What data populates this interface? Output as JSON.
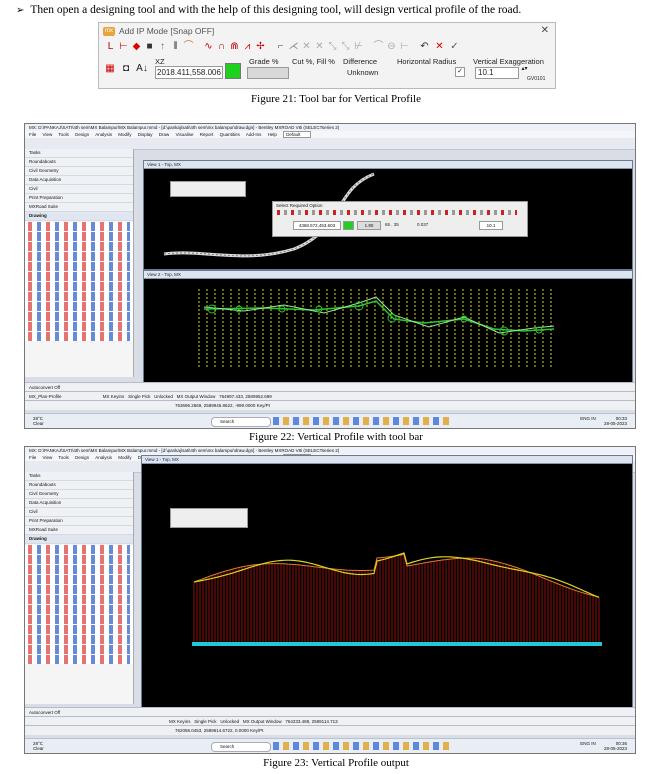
{
  "intro": {
    "bullet": "➢",
    "text": "Then open a designing tool and with the help of this designing tool, will design vertical profile of the road."
  },
  "figure21": {
    "caption": "Figure 21: Tool bar for Vertical Profile",
    "toolbar": {
      "title": "Add IP Mode [Snap OFF]",
      "logo": "mx",
      "xz_label": "XZ",
      "xz_value": "2018.411,558.006",
      "grade_label": "Grade %",
      "cutfill_label": "Cut %, Fill %",
      "difference_label": "Difference",
      "difference_value": "Unknown",
      "horizontal_radius_label": "Horizontal Radius",
      "vertical_exaggeration_label": "Vertical Exaggeration",
      "vertical_exaggeration_value": "10.1",
      "tool_code": "GV0101",
      "colors": {
        "status_fill": "#1fd11f",
        "accent": "#e8a43a"
      }
    }
  },
  "figure22": {
    "caption": "Figure 22: Vertical Profile with tool bar",
    "window_title": "MX: D:\\PANKAJ\\SATI\\4th sem\\MX Balampur\\MX Balampur.mmd - [d:\\pankaj\\sati\\4th sem\\mx balampur\\draw.dgn] - Bentley MXROAD V8i (SELECTseries 2)",
    "menu": [
      "File",
      "View",
      "Tools",
      "Design",
      "Analysis",
      "Modify",
      "Display",
      "Draw",
      "Visualise",
      "Report",
      "Quantities",
      "Add-Ins",
      "Help"
    ],
    "default_label": "Default",
    "tasks_label": "Tasks",
    "sidebar_items": [
      "Roundabouts",
      "Civil Geometry",
      "Data Acquisition",
      "Civil",
      "Print Preparation",
      "MXRoad Suite",
      "Drawing"
    ],
    "view1_title": "View 1 - Top, MX",
    "view2_title": "View 2 - Top, MX",
    "popup_title": "Select Required Option",
    "popup_xz": "4368.572,453.603",
    "popup_grade": "1.80",
    "popup_cutfill": "65 . 35",
    "popup_difference": "0.037",
    "popup_vex": "10.1",
    "autoconvert_label": "Autoconvert Off",
    "plan_profile_label": "MX_Plan-Profile",
    "status_labels": [
      "MX Keyins",
      "Single Pick",
      "Unlocked",
      "MX Output Window"
    ],
    "coordinate_readout": "764997.433, 2589952.699",
    "status_coordinates": "763696.2669, 2589945.8622, -999.0000 Key/Pt",
    "taskbar": {
      "temperature": "28°C",
      "weather": "Clear",
      "search": "Search",
      "lang": "ENG IN",
      "time": "00:33",
      "date": "28-05-2023"
    }
  },
  "figure23": {
    "caption": "Figure 23: Vertical Profile output",
    "window_title": "MX: D:\\PANKAJ\\SATI\\4th sem\\MX Balampur\\MX Balampur.mmd - [d:\\pankaj\\sati\\4th sem\\mx balampur\\draw.dgn] - Bentley MXROAD V8i (SELECTseries 2)",
    "view1_title": "View 1 - Top, MX",
    "status_labels": [
      "MX Keyins",
      "Single Pick",
      "Unlocked",
      "MX Output Window"
    ],
    "coordinate_readout": "764233.488, 2589114.713",
    "status_coordinates": "762056.0453, 2589614.6722, 0.0000 Key/Pt",
    "taskbar": {
      "temperature": "28°C",
      "weather": "Clear",
      "search": "Search",
      "lang": "ENG IN",
      "time": "00:36",
      "date": "28-05-2023"
    }
  }
}
